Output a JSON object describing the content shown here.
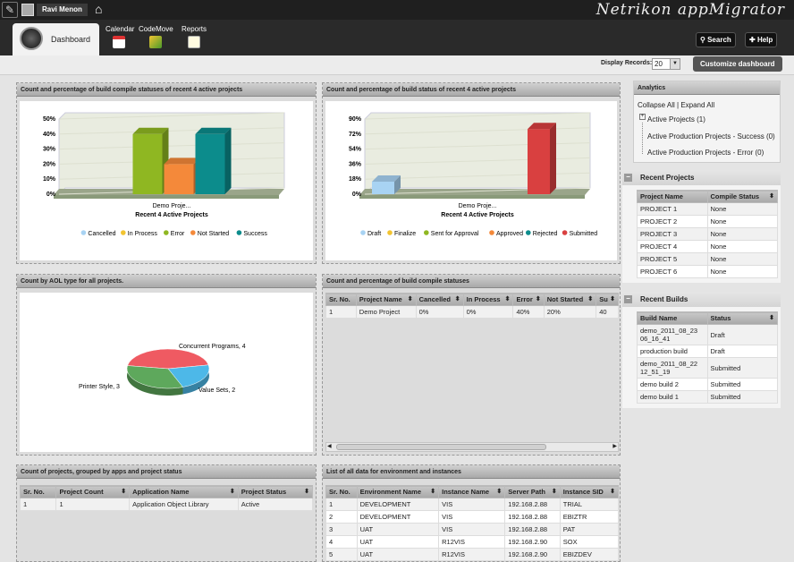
{
  "header": {
    "user_name": "Ravi Menon",
    "brand": "Netrikon appMigrator",
    "search_label": "Search",
    "help_label": "Help"
  },
  "nav": {
    "dashboard_label": "Dashboard",
    "calendar_label": "Calendar",
    "codemove_label": "CodeMove",
    "reports_label": "Reports"
  },
  "strip": {
    "display_records_label": "Display Records:",
    "display_records_value": "20",
    "customize_label": "Customize dashboard"
  },
  "panels": {
    "compile_chart_title": "Count and percentage of build compile statuses of recent 4 active projects",
    "status_chart_title": "Count and percentage of build status of recent 4 active projects",
    "aol_title": "Count by AOL type for all projects.",
    "compile_table_title": "Count and percentage of build compile statuses",
    "projects_table_title": "Count of projects, grouped by apps and project status",
    "env_table_title": "List of all data for environment and instances"
  },
  "chart_data": [
    {
      "type": "bar",
      "title": "Recent 4 Active Projects",
      "categories": [
        "Demo Proje..."
      ],
      "ylim": [
        0,
        50
      ],
      "y_ticks": [
        "0%",
        "10%",
        "20%",
        "30%",
        "40%",
        "50%"
      ],
      "series": [
        {
          "name": "Cancelled",
          "values": [
            0
          ],
          "color": "#a8d3f3"
        },
        {
          "name": "In Process",
          "values": [
            0
          ],
          "color": "#f2c431"
        },
        {
          "name": "Error",
          "values": [
            40
          ],
          "color": "#8fb722"
        },
        {
          "name": "Not Started",
          "values": [
            20
          ],
          "color": "#f4893a"
        },
        {
          "name": "Success",
          "values": [
            40
          ],
          "color": "#0c8c8c"
        }
      ]
    },
    {
      "type": "bar",
      "title": "Recent 4 Active Projects",
      "categories": [
        "Demo Proje..."
      ],
      "ylim": [
        0,
        90
      ],
      "y_ticks": [
        "0%",
        "18%",
        "36%",
        "54%",
        "72%",
        "90%"
      ],
      "series": [
        {
          "name": "Draft",
          "values": [
            15
          ],
          "color": "#a8d3f3"
        },
        {
          "name": "Finalize",
          "values": [
            0
          ],
          "color": "#f2c431"
        },
        {
          "name": "Sent for Approval",
          "values": [
            0
          ],
          "color": "#8fb722"
        },
        {
          "name": "Approved",
          "values": [
            0
          ],
          "color": "#f4893a"
        },
        {
          "name": "Rejected",
          "values": [
            0
          ],
          "color": "#0c8c8c"
        },
        {
          "name": "Submitted",
          "values": [
            78
          ],
          "color": "#d94040"
        }
      ]
    },
    {
      "type": "pie",
      "slices": [
        {
          "label": "Concurrent Programs, 4",
          "value": 4,
          "color": "#ef5a62"
        },
        {
          "label": "Value Sets, 2",
          "value": 2,
          "color": "#4db8e8"
        },
        {
          "label": "Printer Style, 3",
          "value": 3,
          "color": "#5ea85c"
        }
      ]
    }
  ],
  "compile_table": {
    "columns": [
      "Sr. No.",
      "Project Name",
      "Cancelled",
      "In Process",
      "Error",
      "Not Started",
      "Su"
    ],
    "rows": [
      [
        "1",
        "Demo Project",
        "0%",
        "0%",
        "40%",
        "20%",
        "40"
      ]
    ]
  },
  "projects_table": {
    "columns": [
      "Sr. No.",
      "Project Count",
      "Application Name",
      "Project Status"
    ],
    "rows": [
      [
        "1",
        "1",
        "Application Object Library",
        "Active"
      ]
    ]
  },
  "env_table": {
    "columns": [
      "Sr. No.",
      "Environment Name",
      "Instance Name",
      "Server Path",
      "Instance SID"
    ],
    "rows": [
      [
        "1",
        "DEVELOPMENT",
        "VIS",
        "192.168.2.88",
        "TRIAL"
      ],
      [
        "2",
        "DEVELOPMENT",
        "VIS",
        "192.168.2.88",
        "EBIZTR"
      ],
      [
        "3",
        "UAT",
        "VIS",
        "192.168.2.88",
        "PAT"
      ],
      [
        "4",
        "UAT",
        "R12VIS",
        "192.168.2.90",
        "SOX"
      ],
      [
        "5",
        "UAT",
        "R12VIS",
        "192.168.2.90",
        "EBIZDEV"
      ]
    ]
  },
  "analytics": {
    "title": "Analytics",
    "links": "Collapse All | Expand All",
    "items": [
      {
        "label": "Active Projects (1)"
      },
      {
        "label": "Active Production Projects - Success (0)"
      },
      {
        "label": "Active Production Projects - Error (0)"
      }
    ]
  },
  "recent_projects": {
    "title": "Recent Projects",
    "columns": [
      "Project Name",
      "Compile Status"
    ],
    "rows": [
      [
        "PROJECT 1",
        "None"
      ],
      [
        "PROJECT 2",
        "None"
      ],
      [
        "PROJECT 3",
        "None"
      ],
      [
        "PROJECT 4",
        "None"
      ],
      [
        "PROJECT 5",
        "None"
      ],
      [
        "PROJECT 6",
        "None"
      ]
    ]
  },
  "recent_builds": {
    "title": "Recent Builds",
    "columns": [
      "Build Name",
      "Status"
    ],
    "rows": [
      [
        "demo_2011_08_23 06_16_41",
        "Draft"
      ],
      [
        "production build",
        "Draft"
      ],
      [
        "demo_2011_08_22 12_51_19",
        "Submitted"
      ],
      [
        "demo build 2",
        "Submitted"
      ],
      [
        "demo build 1",
        "Submitted"
      ]
    ]
  }
}
